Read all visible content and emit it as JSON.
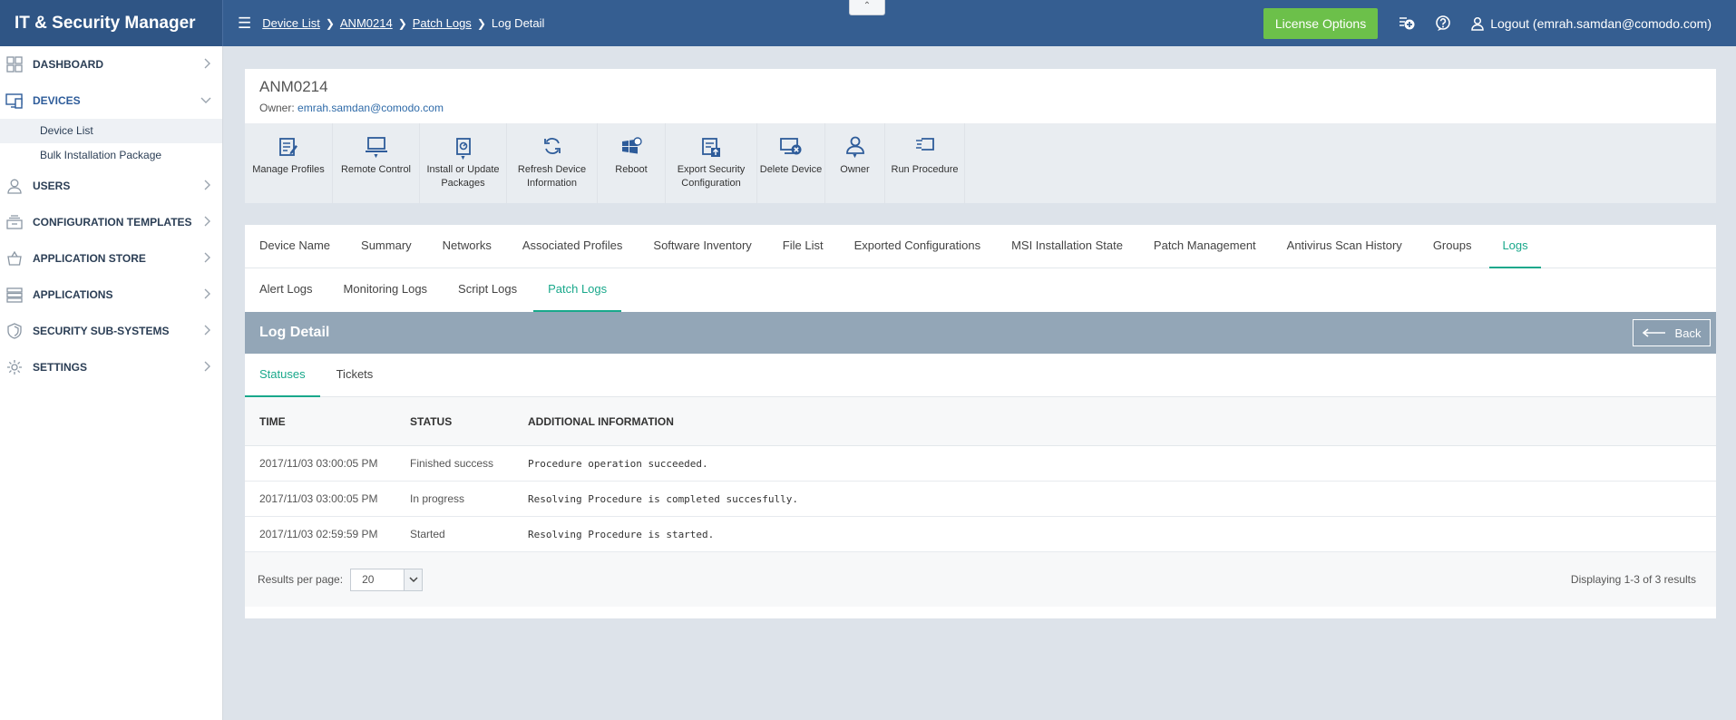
{
  "app": {
    "title": "IT & Security Manager"
  },
  "breadcrumb": {
    "items": [
      "Device List",
      "ANM0214",
      "Patch Logs"
    ],
    "current": "Log Detail"
  },
  "header": {
    "license_label": "License Options",
    "logout_label": "Logout (emrah.samdan@comodo.com)"
  },
  "sidebar": {
    "items": [
      {
        "label": "DASHBOARD",
        "icon": "dashboard-icon"
      },
      {
        "label": "DEVICES",
        "icon": "devices-icon"
      },
      {
        "label": "USERS",
        "icon": "user-icon"
      },
      {
        "label": "CONFIGURATION TEMPLATES",
        "icon": "templates-icon"
      },
      {
        "label": "APPLICATION STORE",
        "icon": "store-icon"
      },
      {
        "label": "APPLICATIONS",
        "icon": "applications-icon"
      },
      {
        "label": "SECURITY SUB-SYSTEMS",
        "icon": "shield-icon"
      },
      {
        "label": "SETTINGS",
        "icon": "gear-icon"
      }
    ],
    "devices_sub": [
      "Device List",
      "Bulk Installation Package"
    ]
  },
  "device": {
    "name": "ANM0214",
    "owner_prefix": "Owner:",
    "owner_email": "emrah.samdan@comodo.com"
  },
  "toolbar": {
    "items": [
      {
        "label": "Manage Profiles"
      },
      {
        "label": "Remote Control"
      },
      {
        "label_1": "Install or Update",
        "label_2": "Packages"
      },
      {
        "label_1": "Refresh Device",
        "label_2": "Information"
      },
      {
        "label": "Reboot"
      },
      {
        "label_1": "Export Security",
        "label_2": "Configuration"
      },
      {
        "label": "Delete Device"
      },
      {
        "label": "Owner"
      },
      {
        "label": "Run Procedure"
      }
    ]
  },
  "tabs": [
    "Device Name",
    "Summary",
    "Networks",
    "Associated Profiles",
    "Software Inventory",
    "File List",
    "Exported Configurations",
    "MSI Installation State",
    "Patch Management",
    "Antivirus Scan History",
    "Groups",
    "Logs"
  ],
  "subtabs": [
    "Alert Logs",
    "Monitoring Logs",
    "Script Logs",
    "Patch Logs"
  ],
  "log_detail": {
    "title": "Log Detail",
    "back_label": "Back",
    "tabs": [
      "Statuses",
      "Tickets"
    ],
    "columns": [
      "TIME",
      "STATUS",
      "ADDITIONAL INFORMATION"
    ],
    "rows": [
      {
        "time": "2017/11/03 03:00:05 PM",
        "status": "Finished success",
        "info": "Procedure operation succeeded."
      },
      {
        "time": "2017/11/03 03:00:05 PM",
        "status": "In progress",
        "info": "Resolving Procedure is completed succesfully."
      },
      {
        "time": "2017/11/03 02:59:59 PM",
        "status": "Started",
        "info": "Resolving Procedure is started."
      }
    ],
    "results_per_page_label": "Results per page:",
    "results_per_page": "20",
    "displaying": "Displaying 1-3 of 3 results"
  }
}
